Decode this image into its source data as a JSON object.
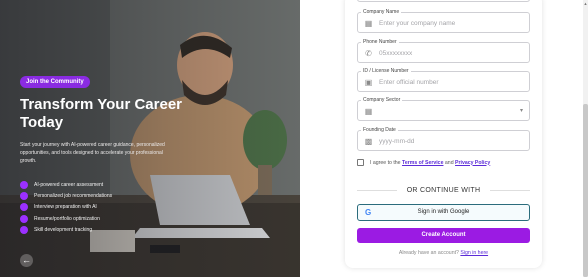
{
  "hero": {
    "badge": "Join the Community",
    "title": "Transform Your Career Today",
    "subtitle": "Start your journey with AI-powered career guidance, personalized opportunities, and tools designed to accelerate your professional growth.",
    "features": [
      "AI-powered career assessment",
      "Personalized job recommendations",
      "Interview preparation with AI",
      "Resume/portfolio optimization",
      "Skill development tracking"
    ]
  },
  "form": {
    "company_name": {
      "label": "Company Name",
      "placeholder": "Enter your company name",
      "icon": "building-icon"
    },
    "phone": {
      "label": "Phone Number",
      "placeholder": "05xxxxxxxx",
      "icon": "phone-icon"
    },
    "license": {
      "label": "ID / License Number",
      "placeholder": "Enter official number",
      "icon": "id-card-icon"
    },
    "sector": {
      "label": "Company Sector",
      "value": "",
      "icon": "building-icon"
    },
    "founding": {
      "label": "Founding Date",
      "placeholder": "yyyy-mm-dd",
      "icon": "calendar-icon"
    },
    "terms": {
      "prefix": "I agree to the",
      "tos": "Terms of Service",
      "and": "and",
      "privacy": "Privacy Policy"
    },
    "divider": "OR CONTINUE WITH",
    "google": "Sign in with Google",
    "create": "Create Account",
    "signin_prefix": "Already have an account?",
    "signin_link": "Sign in here"
  },
  "colors": {
    "accent": "#9b1be3",
    "link": "#5b2bd8",
    "google_border": "#2b6c7c"
  }
}
